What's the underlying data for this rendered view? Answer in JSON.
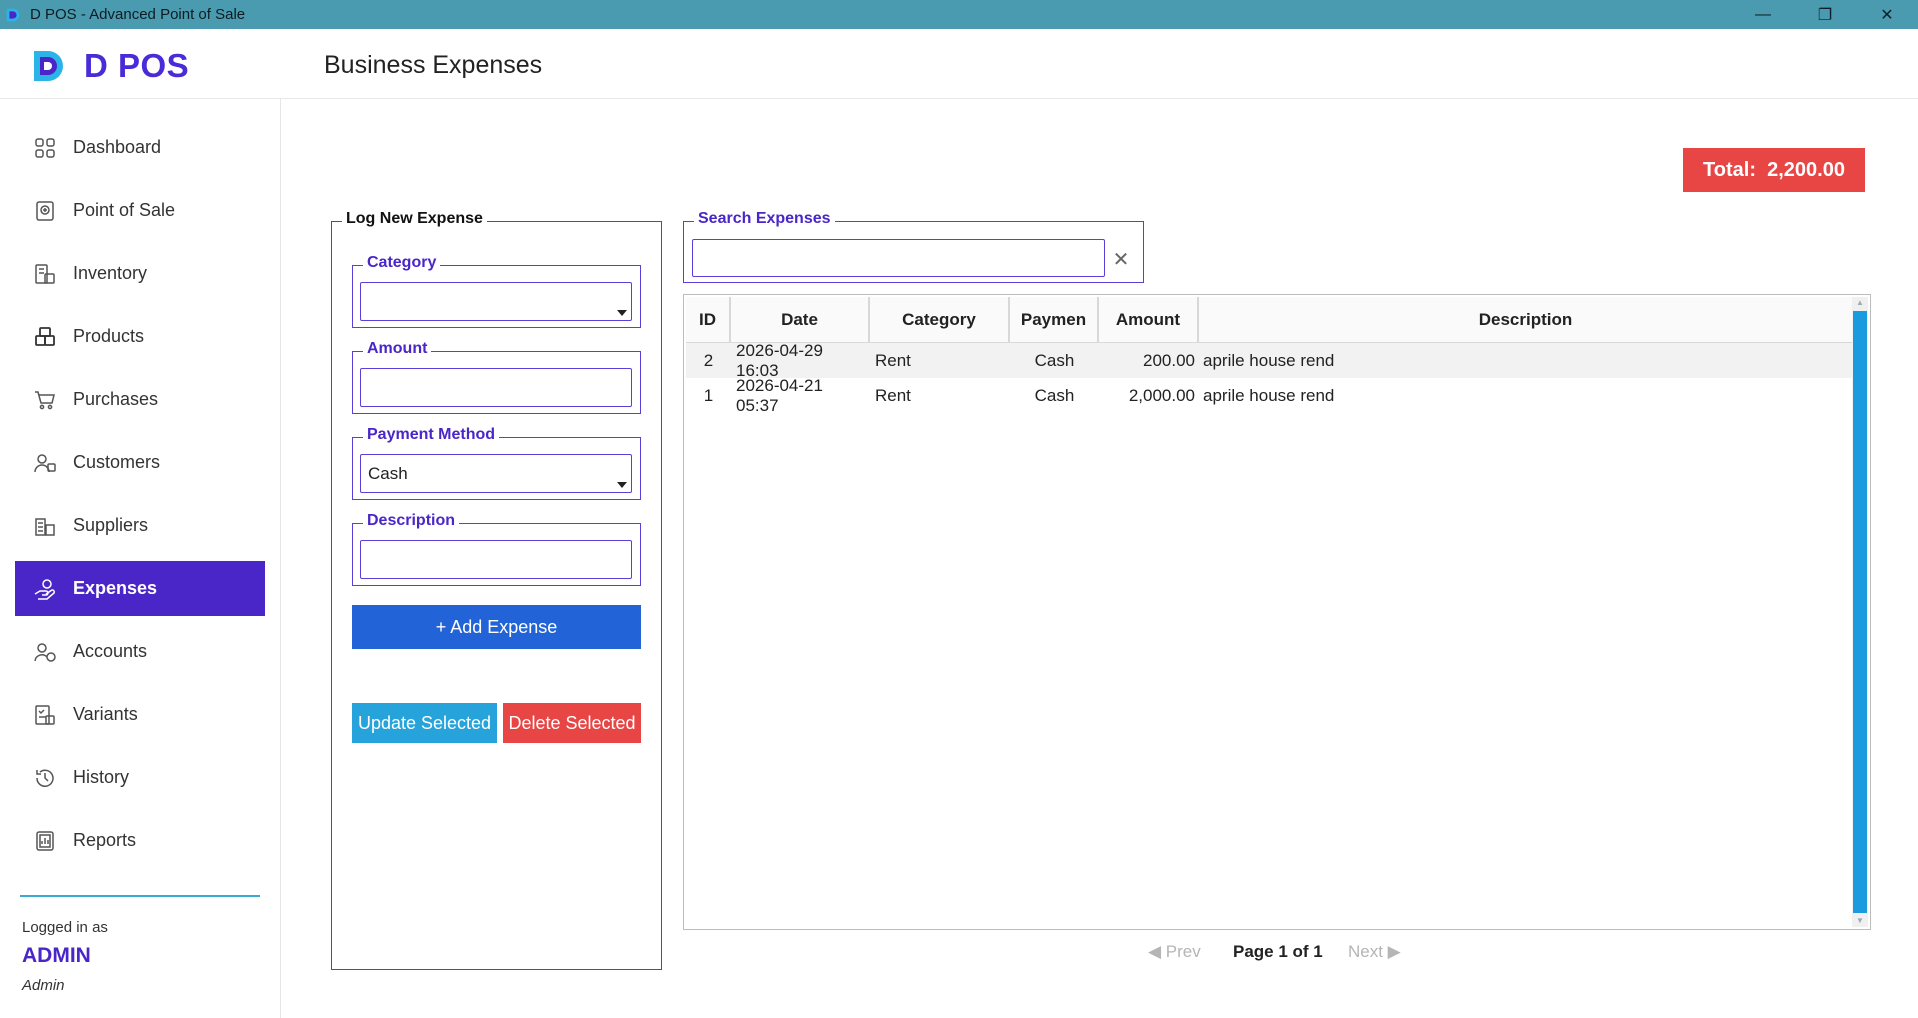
{
  "window": {
    "title": "D POS - Advanced Point of Sale",
    "controls": {
      "minimize": "—",
      "restore": "❐",
      "close": "✕"
    }
  },
  "header": {
    "logo_text": "D POS",
    "page_title": "Business Expenses"
  },
  "sidebar": {
    "items": [
      {
        "label": "Dashboard",
        "icon": "grid-icon"
      },
      {
        "label": "Point of Sale",
        "icon": "register-icon"
      },
      {
        "label": "Inventory",
        "icon": "boxes-icon"
      },
      {
        "label": "Products",
        "icon": "package-icon"
      },
      {
        "label": "Purchases",
        "icon": "cart-icon"
      },
      {
        "label": "Customers",
        "icon": "user-icon"
      },
      {
        "label": "Suppliers",
        "icon": "building-icon"
      },
      {
        "label": "Expenses",
        "icon": "hand-coin-icon",
        "active": true
      },
      {
        "label": "Accounts",
        "icon": "account-icon"
      },
      {
        "label": "Variants",
        "icon": "checklist-icon"
      },
      {
        "label": "History",
        "icon": "history-icon"
      },
      {
        "label": "Reports",
        "icon": "report-icon"
      }
    ],
    "logged_in_label": "Logged in as",
    "user_name": "ADMIN",
    "user_role": "Admin"
  },
  "total": {
    "label": "Total:",
    "value": "2,200.00"
  },
  "log_form": {
    "legend": "Log New Expense",
    "category": {
      "label": "Category",
      "value": ""
    },
    "amount": {
      "label": "Amount",
      "value": ""
    },
    "payment_method": {
      "label": "Payment Method",
      "value": "Cash"
    },
    "description": {
      "label": "Description",
      "value": ""
    },
    "add_button": "+ Add Expense",
    "update_button": "Update Selected",
    "delete_button": "Delete Selected"
  },
  "search": {
    "legend": "Search Expenses",
    "value": "",
    "clear_icon": "✕"
  },
  "table": {
    "columns": [
      "ID",
      "Date",
      "Category",
      "Paymen",
      "Amount",
      "Description"
    ],
    "rows": [
      {
        "id": "2",
        "date": "2026-04-29 16:03",
        "category": "Rent",
        "payment": "Cash",
        "amount": "200.00",
        "description": "aprile house rend"
      },
      {
        "id": "1",
        "date": "2026-04-21 05:37",
        "category": "Rent",
        "payment": "Cash",
        "amount": "2,000.00",
        "description": "aprile house rend"
      }
    ]
  },
  "pagination": {
    "prev": "◀ Prev",
    "page_label": "Page 1 of 1",
    "next": "Next ▶"
  },
  "colors": {
    "titlebar": "#4a9bb0",
    "accent": "#4a26c8",
    "add_button": "#2264d8",
    "update_button": "#27a3dc",
    "delete_button": "#e84545",
    "total_badge": "#e84545",
    "scrollbar_thumb": "#1a9be0"
  }
}
